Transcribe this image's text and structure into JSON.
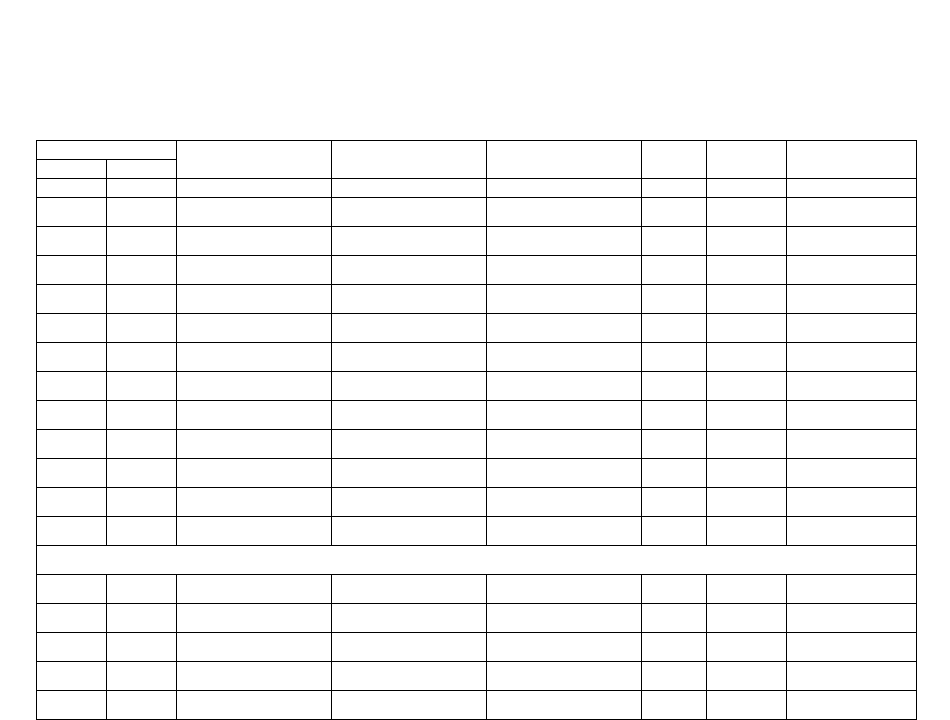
{
  "table": {
    "columns": [
      {
        "id": "a",
        "width": 70,
        "header_top": "",
        "header_mid": "",
        "header_bot": ""
      },
      {
        "id": "b",
        "width": 70,
        "header_top": "",
        "header_mid": "",
        "header_bot": ""
      },
      {
        "id": "c",
        "width": 155,
        "header_top": "",
        "header_mid": "",
        "header_bot": ""
      },
      {
        "id": "d",
        "width": 155,
        "header_top": "",
        "header_mid": "",
        "header_bot": ""
      },
      {
        "id": "e",
        "width": 155,
        "header_top": "",
        "header_mid": "",
        "header_bot": ""
      },
      {
        "id": "f",
        "width": 65,
        "header_top": "",
        "header_mid": "",
        "header_bot": ""
      },
      {
        "id": "g",
        "width": 80,
        "header_top": "",
        "header_mid": "",
        "header_bot": ""
      },
      {
        "id": "h",
        "width": 130,
        "header_top": "",
        "header_mid": "",
        "header_bot": ""
      }
    ],
    "sections": [
      {
        "heading": "",
        "rows": [
          {
            "a": "",
            "b": "",
            "c": "",
            "d": "",
            "e": "",
            "f": "",
            "g": "",
            "h": ""
          },
          {
            "a": "",
            "b": "",
            "c": "",
            "d": "",
            "e": "",
            "f": "",
            "g": "",
            "h": ""
          },
          {
            "a": "",
            "b": "",
            "c": "",
            "d": "",
            "e": "",
            "f": "",
            "g": "",
            "h": ""
          },
          {
            "a": "",
            "b": "",
            "c": "",
            "d": "",
            "e": "",
            "f": "",
            "g": "",
            "h": ""
          },
          {
            "a": "",
            "b": "",
            "c": "",
            "d": "",
            "e": "",
            "f": "",
            "g": "",
            "h": ""
          },
          {
            "a": "",
            "b": "",
            "c": "",
            "d": "",
            "e": "",
            "f": "",
            "g": "",
            "h": ""
          },
          {
            "a": "",
            "b": "",
            "c": "",
            "d": "",
            "e": "",
            "f": "",
            "g": "",
            "h": ""
          },
          {
            "a": "",
            "b": "",
            "c": "",
            "d": "",
            "e": "",
            "f": "",
            "g": "",
            "h": ""
          },
          {
            "a": "",
            "b": "",
            "c": "",
            "d": "",
            "e": "",
            "f": "",
            "g": "",
            "h": ""
          },
          {
            "a": "",
            "b": "",
            "c": "",
            "d": "",
            "e": "",
            "f": "",
            "g": "",
            "h": ""
          },
          {
            "a": "",
            "b": "",
            "c": "",
            "d": "",
            "e": "",
            "f": "",
            "g": "",
            "h": ""
          },
          {
            "a": "",
            "b": "",
            "c": "",
            "d": "",
            "e": "",
            "f": "",
            "g": "",
            "h": ""
          }
        ]
      },
      {
        "heading": "",
        "rows": [
          {
            "a": "",
            "b": "",
            "c": "",
            "d": "",
            "e": "",
            "f": "",
            "g": "",
            "h": ""
          },
          {
            "a": "",
            "b": "",
            "c": "",
            "d": "",
            "e": "",
            "f": "",
            "g": "",
            "h": ""
          },
          {
            "a": "",
            "b": "",
            "c": "",
            "d": "",
            "e": "",
            "f": "",
            "g": "",
            "h": ""
          },
          {
            "a": "",
            "b": "",
            "c": "",
            "d": "",
            "e": "",
            "f": "",
            "g": "",
            "h": ""
          },
          {
            "a": "",
            "b": "",
            "c": "",
            "d": "",
            "e": "",
            "f": "",
            "g": "",
            "h": ""
          }
        ]
      }
    ]
  }
}
